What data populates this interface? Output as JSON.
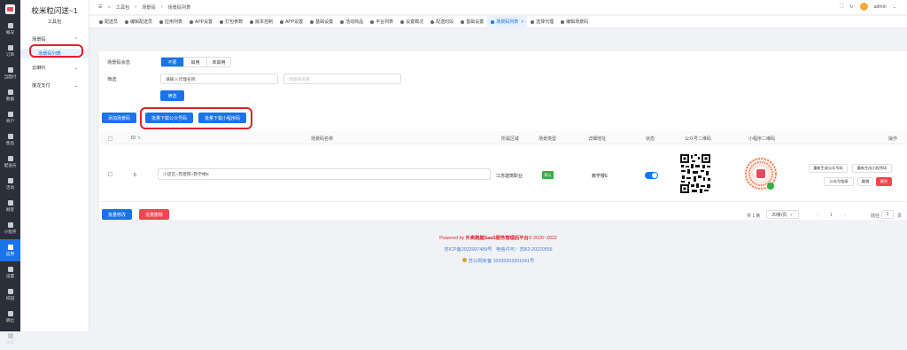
{
  "rail": [
    {
      "label": "概况",
      "icon": "home-icon"
    },
    {
      "label": "订单",
      "icon": "order-icon"
    },
    {
      "label": "当面付",
      "icon": "pay-icon"
    },
    {
      "label": "数据",
      "icon": "chart-icon"
    },
    {
      "label": "商户",
      "icon": "shop-icon"
    },
    {
      "label": "售后",
      "icon": "headset-icon"
    },
    {
      "label": "配送员",
      "icon": "rider-icon"
    },
    {
      "label": "活动",
      "icon": "activity-icon"
    },
    {
      "label": "顾客",
      "icon": "user-icon"
    },
    {
      "label": "小程序",
      "icon": "miniapp-icon"
    },
    {
      "label": "应用",
      "icon": "app-icon"
    },
    {
      "label": "设置",
      "icon": "gear-icon"
    },
    {
      "label": "校园",
      "icon": "lock-icon"
    },
    {
      "label": "跳位",
      "icon": "doc-icon"
    },
    {
      "label": "系统",
      "icon": "system-icon"
    }
  ],
  "sidebar": {
    "title": "校米粒闪送~1",
    "subtitle": "工具包",
    "groups": [
      {
        "label": "场景码",
        "expanded": true,
        "children": [
          "场景码列表"
        ]
      },
      {
        "label": "云喇叭",
        "expanded": false
      },
      {
        "label": "接龙支付",
        "expanded": false
      }
    ]
  },
  "topbar": {
    "breadcrumb": [
      "工具包",
      "场景码",
      "场景码列表"
    ],
    "user": "admin"
  },
  "tabs": [
    "配送员",
    "编辑配送员",
    "应用列表",
    "APP设置",
    "打包参数",
    "版本控制",
    "APP设置",
    "基础设置",
    "活动商品",
    "平台列表",
    "设置概况",
    "配送时段",
    "基础设置",
    "场景码列表",
    "选择代理",
    "编辑场景码"
  ],
  "active_tab": "场景码列表",
  "filter": {
    "status_label": "场景码状态",
    "status_options": [
      "不限",
      "启用",
      "未启用"
    ],
    "status_selected": "不限",
    "filter_label": "筛选",
    "agent_placeholder": "请输入代理名称",
    "name_placeholder": "场景码名称",
    "search_btn": "筛选"
  },
  "actions": {
    "add": "添加场景码",
    "batch_official": "批量下载公众号码",
    "batch_miniapp": "批量下载小程序码"
  },
  "table": {
    "headers": [
      "ID",
      "场景码名称",
      "所属区域",
      "场景类型",
      "详细地址",
      "状态",
      "公众号二维码",
      "小程序二维码",
      "操作"
    ],
    "rows": [
      {
        "id": "5",
        "name": "小店区~苏建院~教学楼E",
        "region": "江苏建筑职业",
        "type": "默认",
        "address": "教学楼E",
        "enabled": true,
        "ops": [
          "重新生成公众号码",
          "重新生成小程序码",
          "公众号链接",
          "编辑",
          "删除"
        ]
      }
    ]
  },
  "bottom": {
    "batch_edit": "批量修改",
    "batch_delete": "批量删除",
    "total": "共 1 条",
    "page_size": "20条/页",
    "page": "1",
    "goto_label": "前往",
    "goto_value": "1",
    "page_unit": "页"
  },
  "footer": {
    "line1_prefix": "Powered by ",
    "line1_brand": "外卖跑腿SaaS服务管理后平台",
    "line1_suffix": "© 2020~2022",
    "icp": "苏ICP备2022007489号",
    "license": "电信许可：苏B2-20220556",
    "police": "苏公网安备 32030302001041号"
  },
  "colors": {
    "accent": "#1a73e8",
    "highlight": "#e0212b",
    "brand": "#e0212b"
  }
}
